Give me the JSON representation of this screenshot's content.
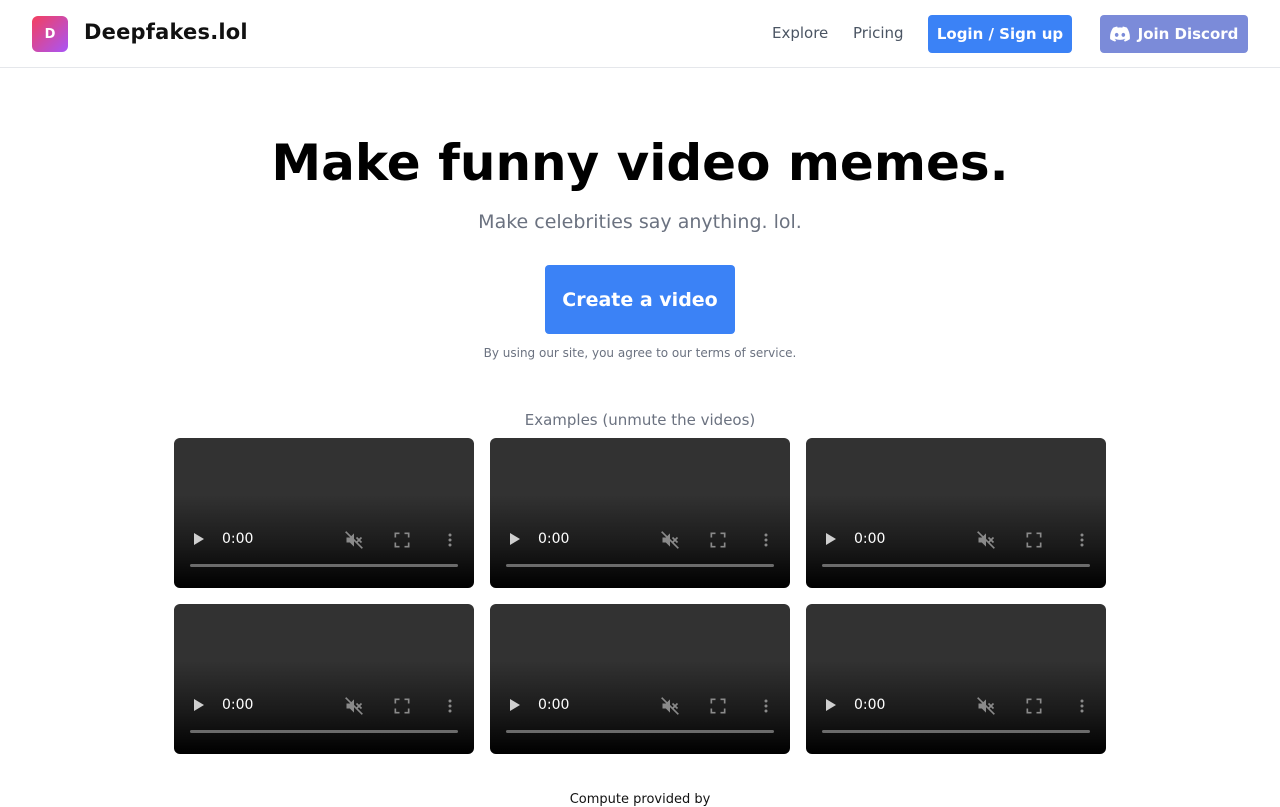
{
  "header": {
    "logo_letter": "D",
    "brand": "Deepfakes.lol",
    "nav": {
      "explore": "Explore",
      "pricing": "Pricing"
    },
    "login_label": "Login / Sign up",
    "discord_label": "Join Discord",
    "discord_icon": "discord-icon"
  },
  "hero": {
    "title": "Make funny video memes.",
    "subtitle": "Make celebrities say anything. lol.",
    "cta_label": "Create a video",
    "terms": "By using our site, you agree to our terms of service."
  },
  "examples": {
    "label": "Examples (unmute the videos)",
    "videos": [
      {
        "time": "0:00",
        "muted": true
      },
      {
        "time": "0:00",
        "muted": true
      },
      {
        "time": "0:00",
        "muted": true
      },
      {
        "time": "0:00",
        "muted": true
      },
      {
        "time": "0:00",
        "muted": true
      },
      {
        "time": "0:00",
        "muted": true
      }
    ]
  },
  "footer": {
    "compute_text": "Compute provided by"
  },
  "colors": {
    "primary": "#3b82f6",
    "discord": "#7b8bd9",
    "logo_gradient_start": "#f43f5e",
    "logo_gradient_end": "#a855f7"
  }
}
